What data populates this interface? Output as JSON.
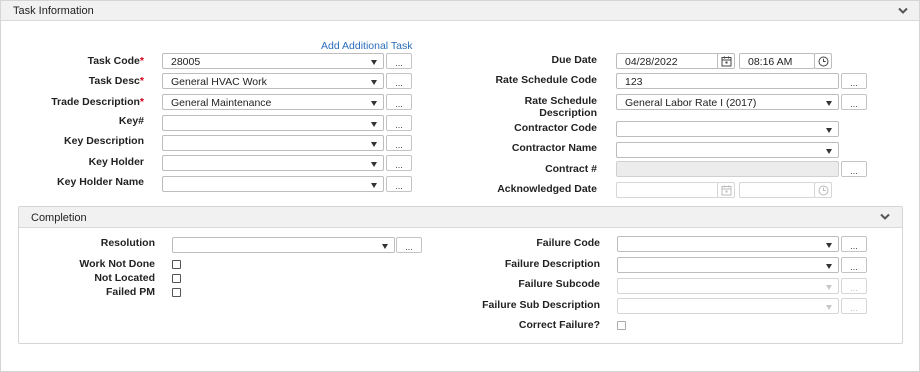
{
  "task_panel": {
    "title": "Task Information",
    "add_link": "Add Additional Task",
    "task_code": {
      "label": "Task Code",
      "value": "28005"
    },
    "task_desc": {
      "label": "Task Desc",
      "value": "General HVAC Work"
    },
    "trade_desc": {
      "label": "Trade Description",
      "value": "General Maintenance"
    },
    "key_num": {
      "label": "Key#",
      "value": ""
    },
    "key_desc": {
      "label": "Key Description",
      "value": ""
    },
    "key_holder": {
      "label": "Key Holder",
      "value": ""
    },
    "key_holder_name": {
      "label": "Key Holder Name",
      "value": ""
    },
    "due_date": {
      "label": "Due Date",
      "date": "04/28/2022",
      "time": "08:16 AM"
    },
    "rate_code": {
      "label": "Rate Schedule Code",
      "value": "123"
    },
    "rate_desc": {
      "label_line1": "Rate Schedule",
      "label_line2": "Description",
      "value": "General Labor Rate I (2017)"
    },
    "contractor_code": {
      "label": "Contractor Code",
      "value": ""
    },
    "contractor_name": {
      "label": "Contractor Name",
      "value": ""
    },
    "contract_num": {
      "label": "Contract #",
      "value": ""
    },
    "ack_date": {
      "label": "Acknowledged Date",
      "date": "",
      "time": ""
    },
    "required_marker": "*",
    "ellipsis": "..."
  },
  "completion_panel": {
    "title": "Completion",
    "resolution": {
      "label": "Resolution",
      "value": ""
    },
    "work_not_done": {
      "label": "Work Not Done",
      "checked": false
    },
    "not_located": {
      "label": "Not Located",
      "checked": false
    },
    "failed_pm": {
      "label": "Failed PM",
      "checked": false
    },
    "failure_code": {
      "label": "Failure Code",
      "value": ""
    },
    "failure_desc": {
      "label": "Failure Description",
      "value": ""
    },
    "failure_subcode": {
      "label": "Failure Subcode",
      "value": ""
    },
    "failure_sub_desc": {
      "label": "Failure Sub Description",
      "value": ""
    },
    "correct_failure": {
      "label": "Correct Failure?",
      "checked": false
    }
  },
  "icons": {
    "collapse": "chevron-down-icon",
    "calendar": "calendar-icon",
    "clock": "clock-icon"
  }
}
